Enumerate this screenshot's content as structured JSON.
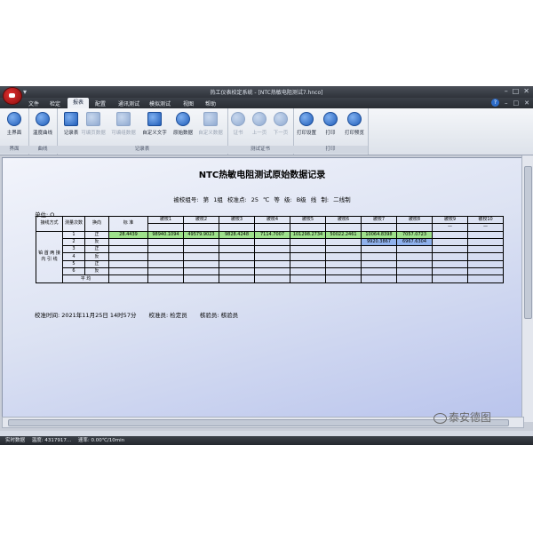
{
  "window": {
    "title": "热工仪表校定系统 - [NTC热敏电阻测试7.hnco]",
    "controls": [
      "–",
      "□",
      "✕"
    ]
  },
  "menu": [
    "文件",
    "检定",
    "报表",
    "配置",
    "通讯测试",
    "模拟测试",
    "视图",
    "帮助"
  ],
  "ribbon": {
    "groups": [
      {
        "label": "界面",
        "buttons": [
          {
            "label": "主界面",
            "enabled": true
          }
        ]
      },
      {
        "label": "曲线",
        "buttons": [
          {
            "label": "温度曲线",
            "enabled": true
          }
        ]
      },
      {
        "label": "记录表",
        "buttons": [
          {
            "label": "记录表",
            "enabled": true
          },
          {
            "label": "可编页数据",
            "enabled": false
          },
          {
            "label": "可编组数据",
            "enabled": false
          },
          {
            "label": "自定义文字",
            "enabled": true
          },
          {
            "label": "原始数据",
            "enabled": true
          },
          {
            "label": "自定义数据",
            "enabled": false
          }
        ]
      },
      {
        "label": "测试证书",
        "buttons": [
          {
            "label": "证书",
            "enabled": false
          },
          {
            "label": "上一页",
            "enabled": false
          },
          {
            "label": "下一页",
            "enabled": false
          }
        ]
      },
      {
        "label": "打印",
        "buttons": [
          {
            "label": "打印设置",
            "enabled": true
          },
          {
            "label": "打印",
            "enabled": true
          },
          {
            "label": "打印预览",
            "enabled": true
          }
        ]
      }
    ]
  },
  "report": {
    "title": "NTC热敏电阻测试原始数据记录",
    "info": "被校组号: 第 1组    校准点:  25 ℃    等 级: B级    线 制: 二线制",
    "unit": "单位:  Ω",
    "headers": {
      "wiring": "接线方式",
      "count": "测量次数",
      "direction": "换向",
      "standard": "标 准",
      "devices": [
        "被校1",
        "被校2",
        "被校3",
        "被校4",
        "被校5",
        "被校6",
        "被校7",
        "被校8",
        "被校9",
        "被校10"
      ],
      "dashes": [
        "—",
        "—"
      ]
    },
    "wiring_label": "铂 首 两 接 内 引 线",
    "rows": [
      {
        "n": "1",
        "dir": "正",
        "std": "28.4439",
        "vals": [
          "98940.1094",
          "49579.9023",
          "9828.4248",
          "7114.7007",
          "101298.2734",
          "50022.2461",
          "10064.8398",
          "7057.0723",
          "",
          ""
        ]
      },
      {
        "n": "2",
        "dir": "反",
        "std": "",
        "vals": [
          "",
          "",
          "",
          "",
          "",
          "",
          "9920.3867",
          "6967.6304",
          "",
          ""
        ]
      },
      {
        "n": "3",
        "dir": "正",
        "std": "",
        "vals": [
          "",
          "",
          "",
          "",
          "",
          "",
          "",
          "",
          "",
          ""
        ]
      },
      {
        "n": "4",
        "dir": "反",
        "std": "",
        "vals": [
          "",
          "",
          "",
          "",
          "",
          "",
          "",
          "",
          "",
          ""
        ]
      },
      {
        "n": "5",
        "dir": "正",
        "std": "",
        "vals": [
          "",
          "",
          "",
          "",
          "",
          "",
          "",
          "",
          "",
          ""
        ]
      },
      {
        "n": "6",
        "dir": "反",
        "std": "",
        "vals": [
          "",
          "",
          "",
          "",
          "",
          "",
          "",
          "",
          "",
          ""
        ]
      }
    ],
    "avg_label": "平 均",
    "footer": {
      "time": "校准时间:  2021年11月25日 14时57分",
      "calibrator": "校准员:  检定员",
      "checker": "核验员:  核验员"
    }
  },
  "status": {
    "label": "实时数据",
    "temp": "温度: 4317917...",
    "rate": "速率: 0.00℃/10min"
  },
  "watermark": "泰安德图",
  "colors": {
    "green_cell": "#9de08a",
    "blue_cell": "#8fb1ec"
  }
}
